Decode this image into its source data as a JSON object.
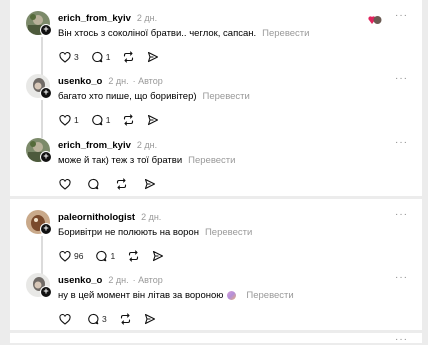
{
  "thread1": {
    "posts": [
      {
        "username": "erich_from_kyiv",
        "time": "2 дн.",
        "author_tag": "",
        "text": "Він хтось з соколіної братви.. чеглок, сапсан.",
        "translate": "Перевести",
        "likes": "3",
        "replies": "1"
      },
      {
        "username": "usenko_o",
        "time": "2 дн.",
        "author_tag": "· Автор",
        "text": "багато хто пише, що боривітер)",
        "translate": "Перевести",
        "likes": "1",
        "replies": "1"
      },
      {
        "username": "erich_from_kyiv",
        "time": "2 дн.",
        "author_tag": "",
        "text": "може й так) теж з тої братви",
        "translate": "Перевести",
        "likes": "",
        "replies": ""
      }
    ]
  },
  "thread2": {
    "posts": [
      {
        "username": "paleornithologist",
        "time": "2 дн.",
        "author_tag": "",
        "text": "Боривітри не полюють на ворон",
        "translate": "Перевести",
        "likes": "96",
        "replies": "1"
      },
      {
        "username": "usenko_o",
        "time": "2 дн.",
        "author_tag": "· Автор",
        "text": "ну в цей момент він літав за вороною",
        "translate": "Перевести",
        "likes": "",
        "replies": "3"
      }
    ]
  },
  "more_label": "···",
  "colors": {
    "accent_reaction": "#e0245e",
    "muted": "#999999"
  }
}
